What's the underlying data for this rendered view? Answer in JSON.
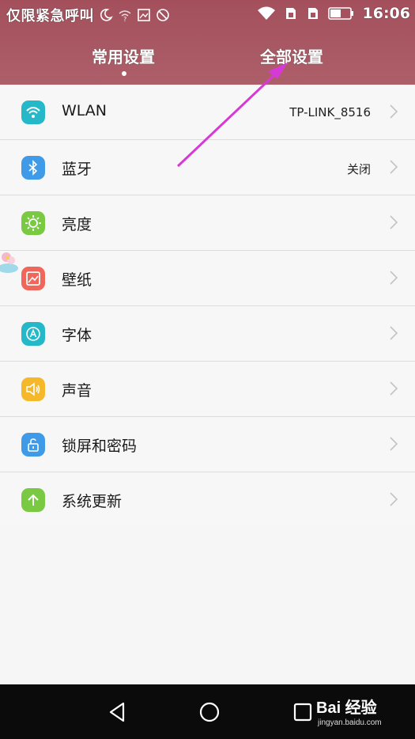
{
  "status_bar": {
    "carrier": "仅限紧急呼叫",
    "time": "16:06",
    "left_icons": [
      "moon-icon",
      "wifi-question-icon",
      "image-icon",
      "no-disturb-icon"
    ],
    "right_icons": [
      "wifi-icon",
      "sim-card-icon",
      "sim-card-2-icon",
      "battery-icon"
    ]
  },
  "tabs": [
    {
      "label": "常用设置",
      "selected": true
    },
    {
      "label": "全部设置",
      "selected": false
    }
  ],
  "settings": [
    {
      "label": "WLAN",
      "value": "TP-LINK_8516",
      "icon": "wifi-icon",
      "color": "#25b8c8"
    },
    {
      "label": "蓝牙",
      "value": "关闭",
      "icon": "bluetooth-icon",
      "color": "#3f9ae8"
    },
    {
      "label": "亮度",
      "value": "",
      "icon": "brightness-icon",
      "color": "#7ac943"
    },
    {
      "label": "壁纸",
      "value": "",
      "icon": "wallpaper-icon",
      "color": "#f1665a"
    },
    {
      "label": "字体",
      "value": "",
      "icon": "font-icon",
      "color": "#25b8c8"
    },
    {
      "label": "声音",
      "value": "",
      "icon": "sound-icon",
      "color": "#f5b82b"
    },
    {
      "label": "锁屏和密码",
      "value": "",
      "icon": "lock-icon",
      "color": "#3f9ae8"
    },
    {
      "label": "系统更新",
      "value": "",
      "icon": "update-icon",
      "color": "#7ac943"
    }
  ],
  "nav": {
    "back_icon": "back-triangle-icon",
    "home_icon": "home-circle-icon",
    "recent_icon": "recent-square-icon"
  },
  "watermark": {
    "logo": "Bai  经验",
    "url": "jingyan.baidu.com"
  },
  "colors": {
    "header": "#a65560",
    "annotation_arrow": "#d63ad6",
    "nav_bar": "#0b0b0b"
  }
}
